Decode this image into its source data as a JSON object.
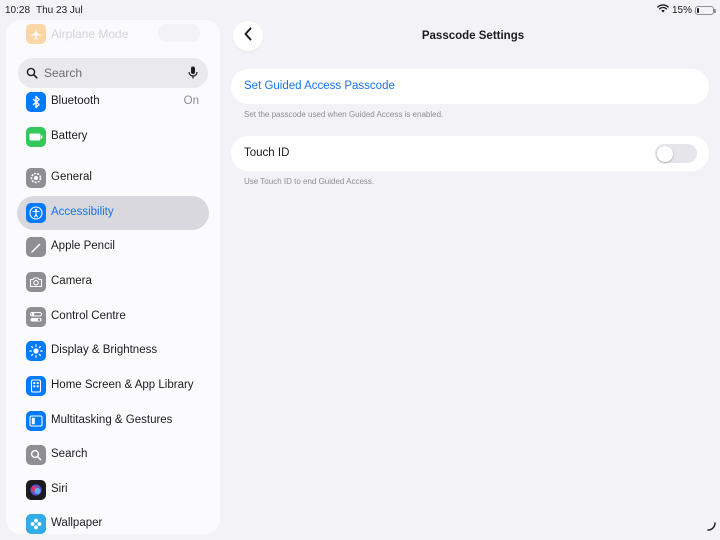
{
  "status_bar": {
    "time": "10:28",
    "date": "Thu 23 Jul",
    "battery": "15%",
    "battery_level": 0.15
  },
  "sidebar": {
    "airplane": {
      "label": "Airplane Mode",
      "icon": "airplane-icon",
      "color": "#ff9500"
    },
    "search": {
      "placeholder": "Search"
    },
    "items": [
      {
        "label": "Bluetooth",
        "value": "On",
        "icon": "bluetooth-icon",
        "color": "#007aff"
      },
      {
        "label": "Battery",
        "icon": "battery-icon",
        "color": "#34c759"
      },
      {
        "label": "General",
        "icon": "gear-icon",
        "color": "#8e8e93"
      },
      {
        "label": "Accessibility",
        "icon": "accessibility-icon",
        "color": "#007aff",
        "selected": true
      },
      {
        "label": "Apple Pencil",
        "icon": "pencil-icon",
        "color": "#8e8e93"
      },
      {
        "label": "Camera",
        "icon": "camera-icon",
        "color": "#8e8e93"
      },
      {
        "label": "Control Centre",
        "icon": "control-centre-icon",
        "color": "#8e8e93"
      },
      {
        "label": "Display & Brightness",
        "icon": "sun-icon",
        "color": "#007aff"
      },
      {
        "label": "Home Screen & App Library",
        "icon": "home-screen-icon",
        "color": "#007aff"
      },
      {
        "label": "Multitasking & Gestures",
        "icon": "multitasking-icon",
        "color": "#007aff"
      },
      {
        "label": "Search",
        "icon": "search-icon",
        "color": "#8e8e93"
      },
      {
        "label": "Siri",
        "icon": "siri-icon",
        "color": "#1c1c1e"
      },
      {
        "label": "Wallpaper",
        "icon": "wallpaper-icon",
        "color": "#32ade6"
      }
    ]
  },
  "main": {
    "title": "Passcode Settings",
    "set_passcode": {
      "label": "Set Guided Access Passcode",
      "footnote": "Set the passcode used when Guided Access is enabled."
    },
    "touch_id": {
      "label": "Touch ID",
      "enabled": false,
      "footnote": "Use Touch ID to end Guided Access."
    }
  },
  "colors": {
    "accent": "#1a73e8",
    "background": "#f2f2f7",
    "selected_row": "#d8d8de"
  }
}
